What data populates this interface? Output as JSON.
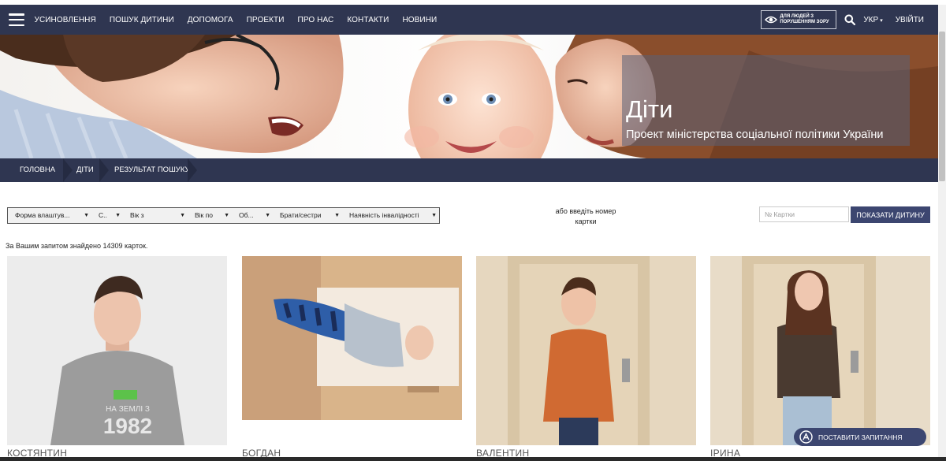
{
  "navbar": {
    "menu_items": [
      "Усиновлення",
      "Пошук дитини",
      "Допомога",
      "Проекти",
      "Про нас",
      "Контакти",
      "Новини"
    ],
    "vision_label_line1": "Для людей з",
    "vision_label_line2": "порушенням зору",
    "language": "УКР",
    "login": "Увійти"
  },
  "hero": {
    "title": "Діти",
    "subtitle": "Проект міністерства соціальної політики України"
  },
  "breadcrumb": [
    "Головна",
    "Діти",
    "Результат пошуку"
  ],
  "filters": {
    "selects": [
      "Форма влаштув...",
      "С..",
      "Вік з",
      "Вік по",
      "Об...",
      "Брати/сестри",
      "Наявність інвалідності"
    ],
    "or_text": "або введіть номер картки",
    "card_placeholder": "№ Картки",
    "show_button": "Показати дитину"
  },
  "results": {
    "count_text": "За Вашим запитом знайдено 14309 карток.",
    "cards": [
      {
        "name": "Костянтин",
        "shirt_text_1": "НА ЗЕМЛІ З",
        "shirt_text_2": "1982"
      },
      {
        "name": "Богдан",
        "shirt_text_1": ""
      },
      {
        "name": "Валентин",
        "shirt_text_1": ""
      },
      {
        "name": "Ірина",
        "shirt_text_1": ""
      }
    ]
  },
  "chat": {
    "ask_button": "Поставити запитання"
  },
  "colors": {
    "navbar": "#2f3651",
    "accent_button": "#3c4670"
  }
}
